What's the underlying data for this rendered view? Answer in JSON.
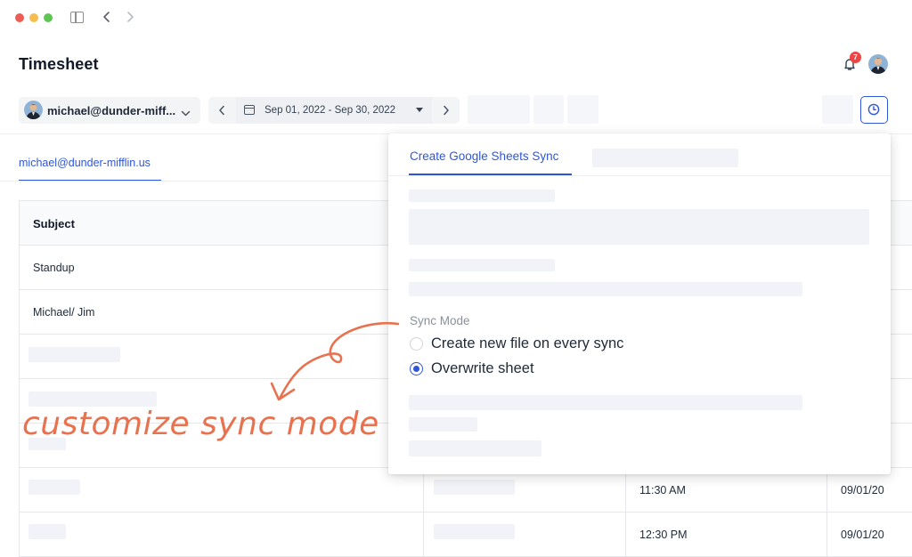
{
  "window": {
    "controls": [
      "close",
      "minimize",
      "maximize"
    ]
  },
  "page": {
    "title": "Timesheet"
  },
  "header": {
    "notifications_count": "7"
  },
  "toolbar": {
    "user_select_label": "michael@dunder-miff...",
    "date_range_label": "Sep 01, 2022 - Sep 30, 2022"
  },
  "tabs": {
    "user_tab": "michael@dunder-mifflin.us"
  },
  "table": {
    "header_subject": "Subject",
    "rows": [
      {
        "subject": "Standup",
        "time": "",
        "date": ""
      },
      {
        "subject": "Michael/ Jim",
        "time": "",
        "date": ""
      },
      {
        "subject": "",
        "time": "",
        "date": ""
      },
      {
        "subject": "",
        "time": "",
        "date": ""
      },
      {
        "subject": "",
        "time": "",
        "date": ""
      },
      {
        "subject": "",
        "time": "11:30 AM",
        "date": "09/01/20"
      },
      {
        "subject": "",
        "time": "12:30 PM",
        "date": "09/01/20"
      }
    ]
  },
  "popover": {
    "tab_active": "Create Google Sheets Sync",
    "sync_mode_label": "Sync Mode",
    "options": [
      {
        "label": "Create new file on every sync",
        "selected": false
      },
      {
        "label": "Overwrite sheet",
        "selected": true
      }
    ]
  },
  "annotation": {
    "text": "customize sync mode"
  },
  "colors": {
    "accent": "#2f56d8",
    "annotation": "#e8724f",
    "badge": "#ef4444"
  },
  "icons": [
    "sidebar-toggle-icon",
    "chevron-left-icon",
    "chevron-right-icon",
    "bell-icon",
    "calendar-icon",
    "chevron-down-icon",
    "clock-icon"
  ]
}
